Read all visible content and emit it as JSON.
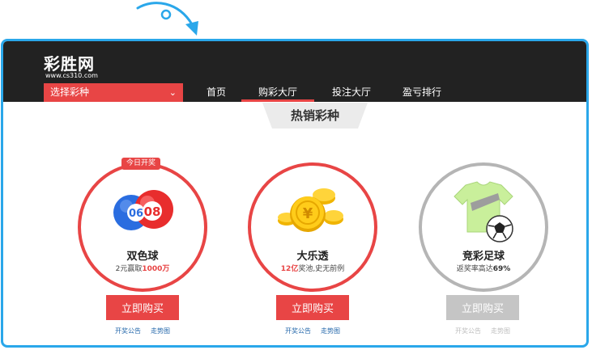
{
  "header": {
    "logo_title": "彩胜网",
    "logo_url": "www.cs310.com",
    "selector_label": "选择彩种",
    "nav": [
      {
        "label": "首页"
      },
      {
        "label": "购彩大厅"
      },
      {
        "label": "投注大厅"
      },
      {
        "label": "盈亏排行"
      }
    ]
  },
  "section_title": "热销彩种",
  "cards": [
    {
      "badge": "今日开奖",
      "name": "双色球",
      "desc_pre": "2元赢取",
      "desc_hl": "1000万",
      "desc_post": "",
      "ball_numbers": [
        "06",
        "08"
      ],
      "buy_label": "立即购买",
      "link1": "开奖公告",
      "link2": "走势图"
    },
    {
      "name": "大乐透",
      "desc_pre": "",
      "desc_hl": "12亿",
      "desc_post": "奖池,史无前例",
      "buy_label": "立即购买",
      "link1": "开奖公告",
      "link2": "走势图"
    },
    {
      "name": "竞彩足球",
      "desc_pre": "返奖率高达",
      "desc_hl": "69%",
      "desc_post": "",
      "buy_label": "立即购买",
      "link1": "开奖公告",
      "link2": "走势图"
    }
  ],
  "colors": {
    "accent": "#e84545",
    "header_bg": "#222222",
    "frame_border": "#2aa7ea",
    "disabled": "#c5c5c5"
  }
}
